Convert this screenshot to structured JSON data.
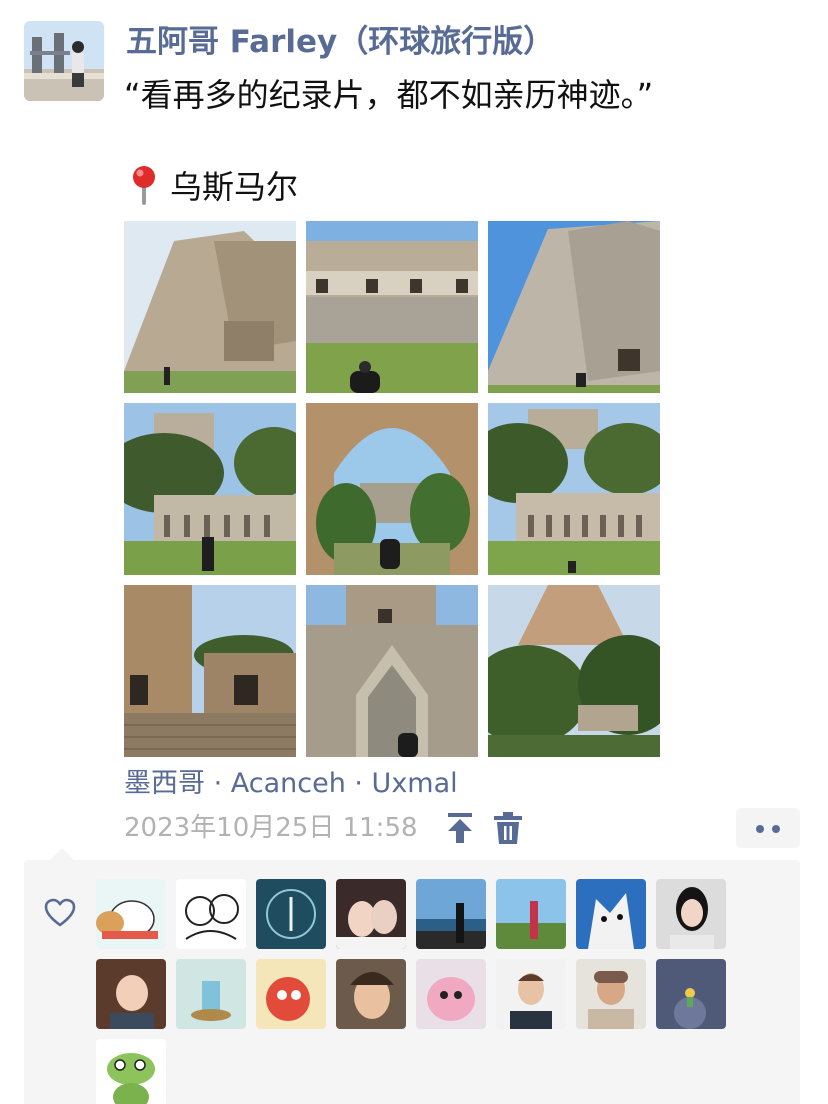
{
  "post": {
    "author_name": "五阿哥 Farley（环球旅行版）",
    "text": "“看再多的纪录片，都不如亲历神迹。”",
    "location_label": "乌斯马尔",
    "place_tag": "墨西哥 · Acanceh · Uxmal",
    "timestamp": "2023年10月25日 11:58"
  },
  "icons": {
    "location": "red-pin-icon",
    "pin_top": "pin-to-top-icon",
    "delete": "trash-icon",
    "more": "more-dots-icon",
    "like": "heart-outline-icon"
  },
  "colors": {
    "name_link": "#576b95",
    "timestamp": "#b2b2b2",
    "panel_bg": "#f5f5f5"
  },
  "photos": [
    "uxmal-pyramid-side",
    "nunnery-quadrangle-facade",
    "magician-pyramid-stairs",
    "long-colonnade-building",
    "stone-arch-view",
    "long-colonnade-building-2",
    "carved-building-corner",
    "corbel-arch-gateway",
    "pyramid-over-trees"
  ],
  "likers_count": 17
}
